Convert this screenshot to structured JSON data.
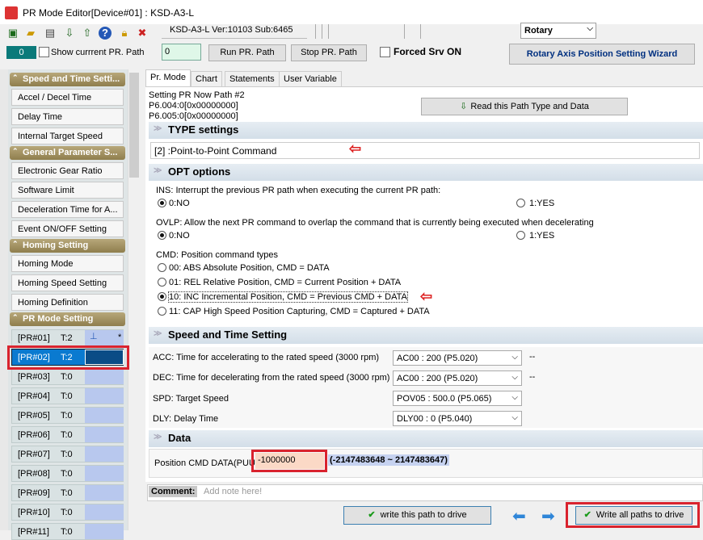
{
  "window": {
    "title": "PR Mode Editor[Device#01]  : KSD-A3-L"
  },
  "toolbar": {
    "version": "KSD-A3-L Ver:10103 Sub:6465",
    "mode_select": "Rotary"
  },
  "row2": {
    "teal_value": "0",
    "show_current": "Show currrent PR. Path",
    "path_input": "0",
    "run": "Run PR. Path",
    "stop": "Stop PR. Path",
    "forced": "Forced Srv ON",
    "wizard": "Rotary Axis Position Setting Wizard"
  },
  "sidebar": {
    "h1": "Speed and Time Setti...",
    "accel": "Accel / Decel Time",
    "delay": "Delay Time",
    "internal": "Internal Target Speed",
    "h2": "General Parameter S...",
    "gear": "Electronic Gear Ratio",
    "soft": "Software Limit",
    "decel": "Deceleration Time for A...",
    "event": "Event ON/OFF Setting",
    "h3": "Homing Setting",
    "hmode": "Homing Mode",
    "hspeed": "Homing Speed Setting",
    "hdef": "Homing Definition",
    "h4": "PR Mode Setting",
    "pr": [
      {
        "l": "[PR#01]",
        "t": "T:2",
        "m": "*"
      },
      {
        "l": "[PR#02]",
        "t": "T:2"
      },
      {
        "l": "[PR#03]",
        "t": "T:0"
      },
      {
        "l": "[PR#04]",
        "t": "T:0"
      },
      {
        "l": "[PR#05]",
        "t": "T:0"
      },
      {
        "l": "[PR#06]",
        "t": "T:0"
      },
      {
        "l": "[PR#07]",
        "t": "T:0"
      },
      {
        "l": "[PR#08]",
        "t": "T:0"
      },
      {
        "l": "[PR#09]",
        "t": "T:0"
      },
      {
        "l": "[PR#10]",
        "t": "T:0"
      },
      {
        "l": "[PR#11]",
        "t": "T:0"
      }
    ]
  },
  "tabs": [
    "Pr. Mode",
    "Chart",
    "Statements",
    "User Variable"
  ],
  "info": {
    "l1": "Setting PR Now Path #2",
    "l2": "P6.004:0[0x00000000]",
    "l3": "P6.005:0[0x00000000]",
    "read": "Read this Path Type and Data"
  },
  "type": {
    "title": "TYPE settings",
    "value": "[2] :Point-to-Point Command"
  },
  "opt": {
    "title": "OPT options",
    "ins": "INS: Interrupt the previous PR path when executing the current PR path:",
    "ins0": "0:NO",
    "ins1": "1:YES",
    "ovlp": "OVLP: Allow the next PR command to overlap the command that is currently being executed when decelerating",
    "ov0": "0:NO",
    "ov1": "1:YES",
    "cmd": "CMD: Position command types",
    "c0": "00: ABS Absolute Position, CMD = DATA",
    "c1": "01: REL Relative Position, CMD = Current Position + DATA",
    "c2": "10: INC Incremental Position, CMD = Previous CMD + DATA",
    "c3": "11: CAP High Speed Position Capturing, CMD = Captured + DATA"
  },
  "speed": {
    "title": "Speed and Time Setting",
    "acc": "ACC: Time for accelerating to the rated speed (3000 rpm)",
    "acc_v": "AC00 : 200 (P5.020)",
    "acc_x": "--",
    "dec": "DEC: Time for decelerating from the rated speed (3000 rpm)",
    "dec_v": "AC00 : 200 (P5.020)",
    "dec_x": "--",
    "spd": "SPD: Target Speed",
    "spd_v": "POV05 : 500.0 (P5.065)",
    "dly": "DLY: Delay Time",
    "dly_v": "DLY00 : 0 (P5.040)"
  },
  "data": {
    "title": "Data",
    "label": "Position CMD DATA(PUU)",
    "value": "-1000000",
    "range": "(-2147483648 ~ 2147483647)"
  },
  "comment": {
    "label": "Comment:",
    "placeholder": "Add note here!"
  },
  "bottom": {
    "write_one": "write this path to drive",
    "write_all": "Write all paths to drive"
  },
  "colors": {
    "red_box": "#d9232e",
    "section": "#dbe4ec",
    "highlight": "#c6d2f0"
  }
}
